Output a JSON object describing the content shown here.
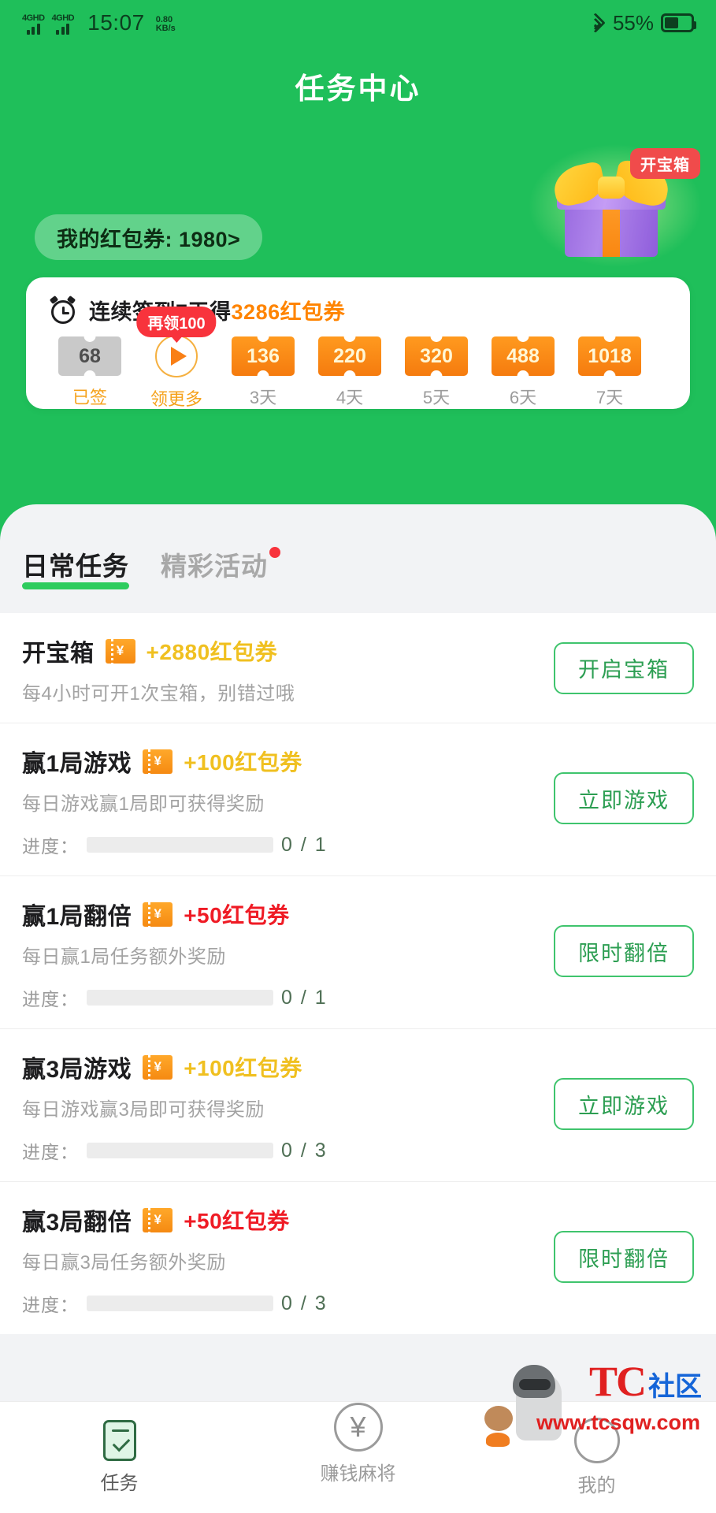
{
  "status_bar": {
    "signal_1_label": "4GHD",
    "signal_2_label": "4GHD",
    "time": "15:07",
    "net_speed_value": "0.80",
    "net_speed_unit": "KB/s",
    "battery_percent": "55%"
  },
  "header": {
    "title": "任务中心",
    "coupon_pill": "我的红包券: 1980>",
    "gift_badge": "开宝箱"
  },
  "signin": {
    "title_prefix": "连续签到7天得",
    "title_amount": "3286红包券",
    "more_badge": "再领100",
    "days": [
      {
        "value": "68",
        "label": "已签",
        "state": "signed"
      },
      {
        "value": "",
        "label": "领更多",
        "state": "more"
      },
      {
        "value": "136",
        "label": "3天",
        "state": "coupon"
      },
      {
        "value": "220",
        "label": "4天",
        "state": "coupon"
      },
      {
        "value": "320",
        "label": "5天",
        "state": "coupon"
      },
      {
        "value": "488",
        "label": "6天",
        "state": "coupon"
      },
      {
        "value": "1018",
        "label": "7天",
        "state": "coupon"
      }
    ]
  },
  "tabs": [
    {
      "label": "日常任务",
      "active": true,
      "dot": false
    },
    {
      "label": "精彩活动",
      "active": false,
      "dot": true
    }
  ],
  "tasks": [
    {
      "name": "开宝箱",
      "reward": "+2880红包券",
      "reward_color": "#f0c020",
      "desc": "每4小时可开1次宝箱，别错过哦",
      "button": "开启宝箱",
      "progress_label": null,
      "progress_text": null,
      "progress_percent": 0
    },
    {
      "name": "赢1局游戏",
      "reward": "+100红包券",
      "reward_color": "#f0c020",
      "desc": "每日游戏赢1局即可获得奖励",
      "button": "立即游戏",
      "progress_label": "进度：",
      "progress_text": "0 / 1",
      "progress_percent": 0
    },
    {
      "name": "赢1局翻倍",
      "reward": "+50红包券",
      "reward_color": "#ef1b25",
      "desc": "每日赢1局任务额外奖励",
      "button": "限时翻倍",
      "progress_label": "进度：",
      "progress_text": "0 / 1",
      "progress_percent": 0
    },
    {
      "name": "赢3局游戏",
      "reward": "+100红包券",
      "reward_color": "#f0c020",
      "desc": "每日游戏赢3局即可获得奖励",
      "button": "立即游戏",
      "progress_label": "进度：",
      "progress_text": "0 / 3",
      "progress_percent": 0
    },
    {
      "name": "赢3局翻倍",
      "reward": "+50红包券",
      "reward_color": "#ef1b25",
      "desc": "每日赢3局任务额外奖励",
      "button": "限时翻倍",
      "progress_label": "进度：",
      "progress_text": "0 / 3",
      "progress_percent": 0
    }
  ],
  "bottom_nav": [
    {
      "label": "任务",
      "icon": "task-checklist-icon",
      "active": true
    },
    {
      "label": "赚钱麻将",
      "icon": "yuan-circle-icon",
      "active": false
    },
    {
      "label": "我的",
      "icon": "profile-circle-icon",
      "active": false
    }
  ],
  "watermark": {
    "brand": "TC",
    "brand_suffix": "社区",
    "url": "www.tcsqw.com"
  },
  "colors": {
    "brand_green": "#1fbf5a",
    "accent_orange": "#ff8400",
    "reward_gold": "#f0c020",
    "reward_red": "#ef1b25",
    "badge_red": "#f8333c"
  }
}
